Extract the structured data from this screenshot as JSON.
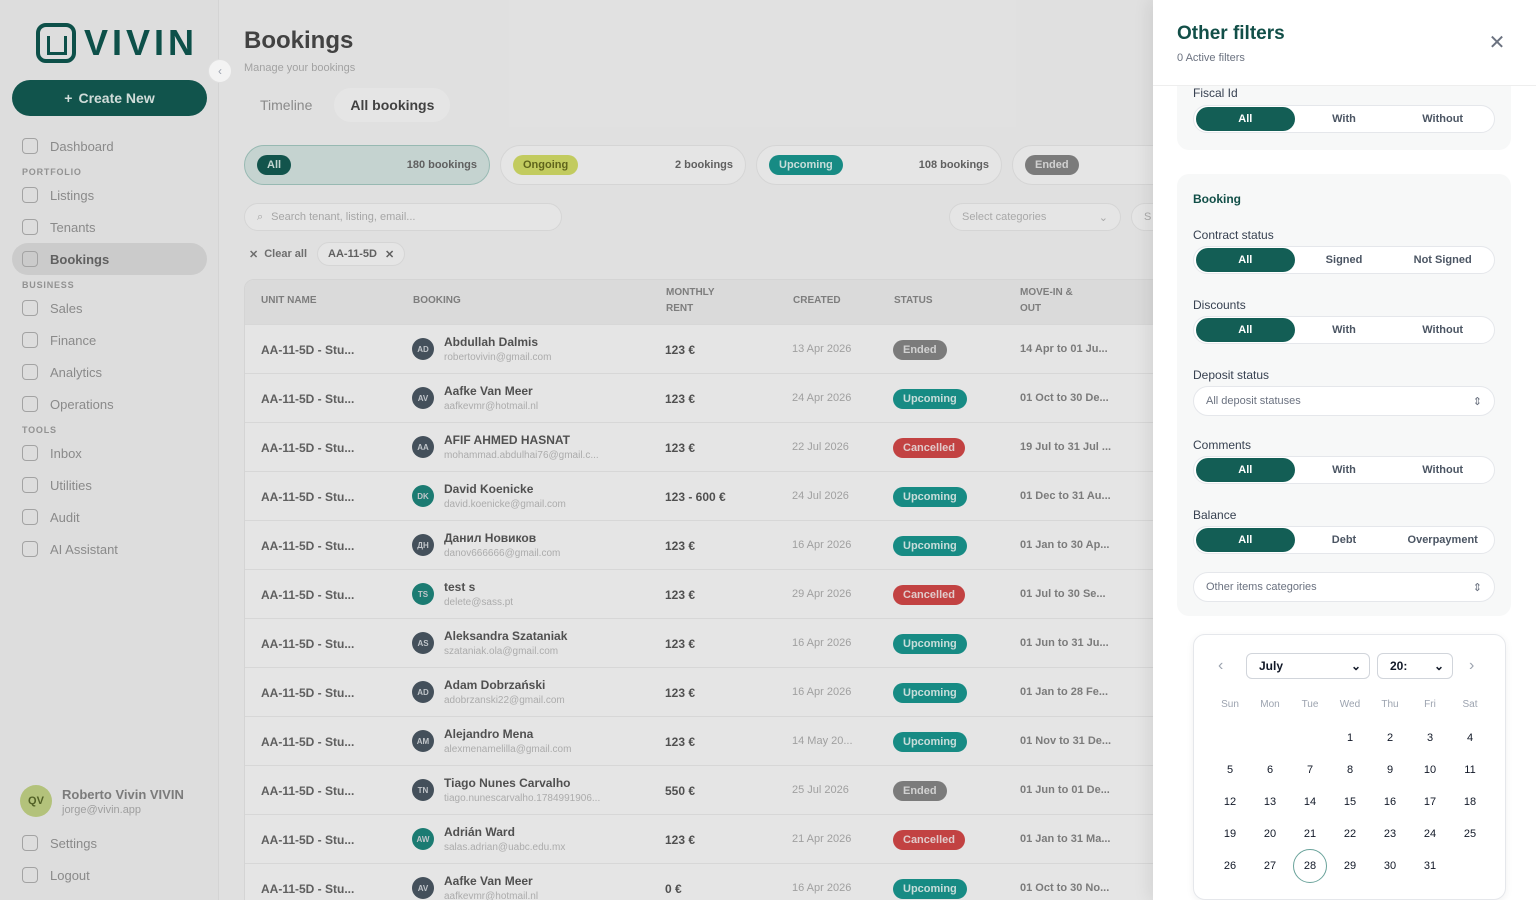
{
  "app": {
    "logo_text": "VIVIN",
    "create_label": "Create New",
    "nav": {
      "dashboard": "Dashboard",
      "portfolio": "PORTFOLIO",
      "listings": "Listings",
      "tenants": "Tenants",
      "bookings": "Bookings",
      "business": "BUSINESS",
      "sales": "Sales",
      "finance": "Finance",
      "analytics": "Analytics",
      "operations": "Operations",
      "tools": "TOOLS",
      "inbox": "Inbox",
      "utilities": "Utilities",
      "audit": "Audit",
      "ai_assistant": "AI Assistant"
    },
    "user": {
      "initials": "QV",
      "name": "Roberto Vivin VIVIN",
      "email": "jorge@vivin.app"
    },
    "settings": "Settings",
    "logout": "Logout"
  },
  "page": {
    "title": "Bookings",
    "subtitle": "Manage your bookings",
    "tabs": [
      "Timeline",
      "All bookings"
    ],
    "status_cards": [
      {
        "pill": "All",
        "count": "180 bookings"
      },
      {
        "pill": "Ongoing",
        "count": "2 bookings"
      },
      {
        "pill": "Upcoming",
        "count": "108 bookings"
      },
      {
        "pill": "Ended",
        "count": ""
      }
    ],
    "search_placeholder": "Search tenant, listing, email...",
    "categories_placeholder": "Select categories",
    "categories2_placeholder": "S",
    "clear_all": "Clear all",
    "active_chip": "AA-11-5D",
    "columns": {
      "unit": "UNIT NAME",
      "booking": "BOOKING",
      "rent_1": "MONTHLY",
      "rent_2": "RENT",
      "created": "CREATED",
      "status": "STATUS",
      "move_1": "MOVE-IN &",
      "move_2": "OUT"
    },
    "rows": [
      {
        "unit": "AA-11-5D - Stu...",
        "initials": "AD",
        "name": "Abdullah Dalmis",
        "email": "robertovivin@gmail.com",
        "rent": "123 €",
        "created": "13 Apr 2026",
        "status": "Ended",
        "move": "14 Apr to 01 Ju..."
      },
      {
        "unit": "AA-11-5D - Stu...",
        "initials": "AV",
        "name": "Aafke Van Meer",
        "email": "aafkevmr@hotmail.nl",
        "rent": "123 €",
        "created": "24 Apr 2026",
        "status": "Upcoming",
        "move": "01 Oct to 30 De..."
      },
      {
        "unit": "AA-11-5D - Stu...",
        "initials": "AA",
        "name": "AFIF AHMED HASNAT",
        "email": "mohammad.abdulhai76@gmail.c...",
        "rent": "123 €",
        "created": "22 Jul 2026",
        "status": "Cancelled",
        "move": "19 Jul to 31 Jul ..."
      },
      {
        "unit": "AA-11-5D - Stu...",
        "initials": "DK",
        "name": "David Koenicke",
        "email": "david.koenicke@gmail.com",
        "rent": "123 - 600 €",
        "created": "24 Jul 2026",
        "status": "Upcoming",
        "move": "01 Dec to 31 Au..."
      },
      {
        "unit": "AA-11-5D - Stu...",
        "initials": "ДН",
        "name": "Данил Новиков",
        "email": "danov666666@gmail.com",
        "rent": "123 €",
        "created": "16 Apr 2026",
        "status": "Upcoming",
        "move": "01 Jan to 30 Ap..."
      },
      {
        "unit": "AA-11-5D - Stu...",
        "initials": "TS",
        "name": "test s",
        "email": "delete@sass.pt",
        "rent": "123 €",
        "created": "29 Apr 2026",
        "status": "Cancelled",
        "move": "01 Jul to 30 Se..."
      },
      {
        "unit": "AA-11-5D - Stu...",
        "initials": "AS",
        "name": "Aleksandra Szataniak",
        "email": "szataniak.ola@gmail.com",
        "rent": "123 €",
        "created": "16 Apr 2026",
        "status": "Upcoming",
        "move": "01 Jun to 31 Ju..."
      },
      {
        "unit": "AA-11-5D - Stu...",
        "initials": "AD",
        "name": "Adam Dobrzański",
        "email": "adobrzanski22@gmail.com",
        "rent": "123 €",
        "created": "16 Apr 2026",
        "status": "Upcoming",
        "move": "01 Jan to 28 Fe..."
      },
      {
        "unit": "AA-11-5D - Stu...",
        "initials": "AM",
        "name": "Alejandro Mena",
        "email": "alexmenamelilla@gmail.com",
        "rent": "123 €",
        "created": "14 May 20...",
        "status": "Upcoming",
        "move": "01 Nov to 31 De..."
      },
      {
        "unit": "AA-11-5D - Stu...",
        "initials": "TN",
        "name": "Tiago Nunes Carvalho",
        "email": "tiago.nunescarvalho.1784991906...",
        "rent": "550 €",
        "created": "25 Jul 2026",
        "status": "Ended",
        "move": "01 Jun to 01 De..."
      },
      {
        "unit": "AA-11-5D - Stu...",
        "initials": "AW",
        "name": "Adrián Ward",
        "email": "salas.adrian@uabc.edu.mx",
        "rent": "123 €",
        "created": "21 Apr 2026",
        "status": "Cancelled",
        "move": "01 Jan to 31 Ma..."
      },
      {
        "unit": "AA-11-5D - Stu...",
        "initials": "AV",
        "name": "Aafke Van Meer",
        "email": "aafkevmr@hotmail.nl",
        "rent": "0 €",
        "created": "16 Apr 2026",
        "status": "Upcoming",
        "move": "01 Oct to 30 No..."
      }
    ]
  },
  "filters": {
    "title": "Other filters",
    "subtitle": "0 Active filters",
    "fiscal_id": {
      "label": "Fiscal Id",
      "options": [
        "All",
        "With",
        "Without"
      ]
    },
    "booking_title": "Booking",
    "contract_status": {
      "label": "Contract status",
      "options": [
        "All",
        "Signed",
        "Not Signed"
      ]
    },
    "discounts": {
      "label": "Discounts",
      "options": [
        "All",
        "With",
        "Without"
      ]
    },
    "deposit_status": {
      "label": "Deposit status",
      "placeholder": "All deposit statuses"
    },
    "comments": {
      "label": "Comments",
      "options": [
        "All",
        "With",
        "Without"
      ]
    },
    "balance": {
      "label": "Balance",
      "options": [
        "All",
        "Debt",
        "Overpayment"
      ]
    },
    "other_items": {
      "placeholder": "Other items categories"
    },
    "calendar": {
      "month": "July",
      "year": "20:",
      "weekdays": [
        "Sun",
        "Mon",
        "Tue",
        "Wed",
        "Thu",
        "Fri",
        "Sat"
      ],
      "selected_day": "28"
    }
  },
  "colors": {
    "brand": "#135e55",
    "upcoming": "#1a9b94",
    "cancelled": "#d84a4a",
    "ended": "#8a8a8a",
    "ongoing": "#d8e36a"
  }
}
